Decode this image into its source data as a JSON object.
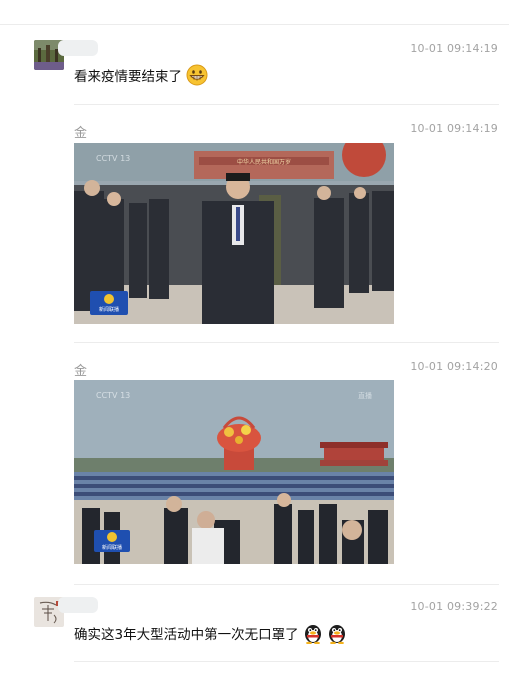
{
  "messages": [
    {
      "sender": "",
      "time": "10-01 09:14:19",
      "text": "看来疫情要结束了",
      "emoji": "grinning-face"
    },
    {
      "sender": "金",
      "time": "10-01 09:14:19",
      "image": {
        "tv_logo": "CCTV 13",
        "badge": "新闻联播",
        "banner": "中华人民共和国万岁"
      }
    },
    {
      "sender": "金",
      "time": "10-01 09:14:20",
      "image": {
        "tv_logo": "CCTV 13",
        "corner": "直播",
        "badge": "新闻联播"
      }
    },
    {
      "sender": "",
      "time": "10-01 09:39:22",
      "text": "确实这3年大型活动中第一次无口罩了",
      "emoji": [
        "qq-penguin",
        "qq-penguin"
      ]
    }
  ],
  "colors": {
    "divider": "#ececec",
    "time": "#a3a3a3",
    "sender": "#9a9a9a",
    "sky": "#9fb0bb",
    "suit": "#2a2d35"
  }
}
